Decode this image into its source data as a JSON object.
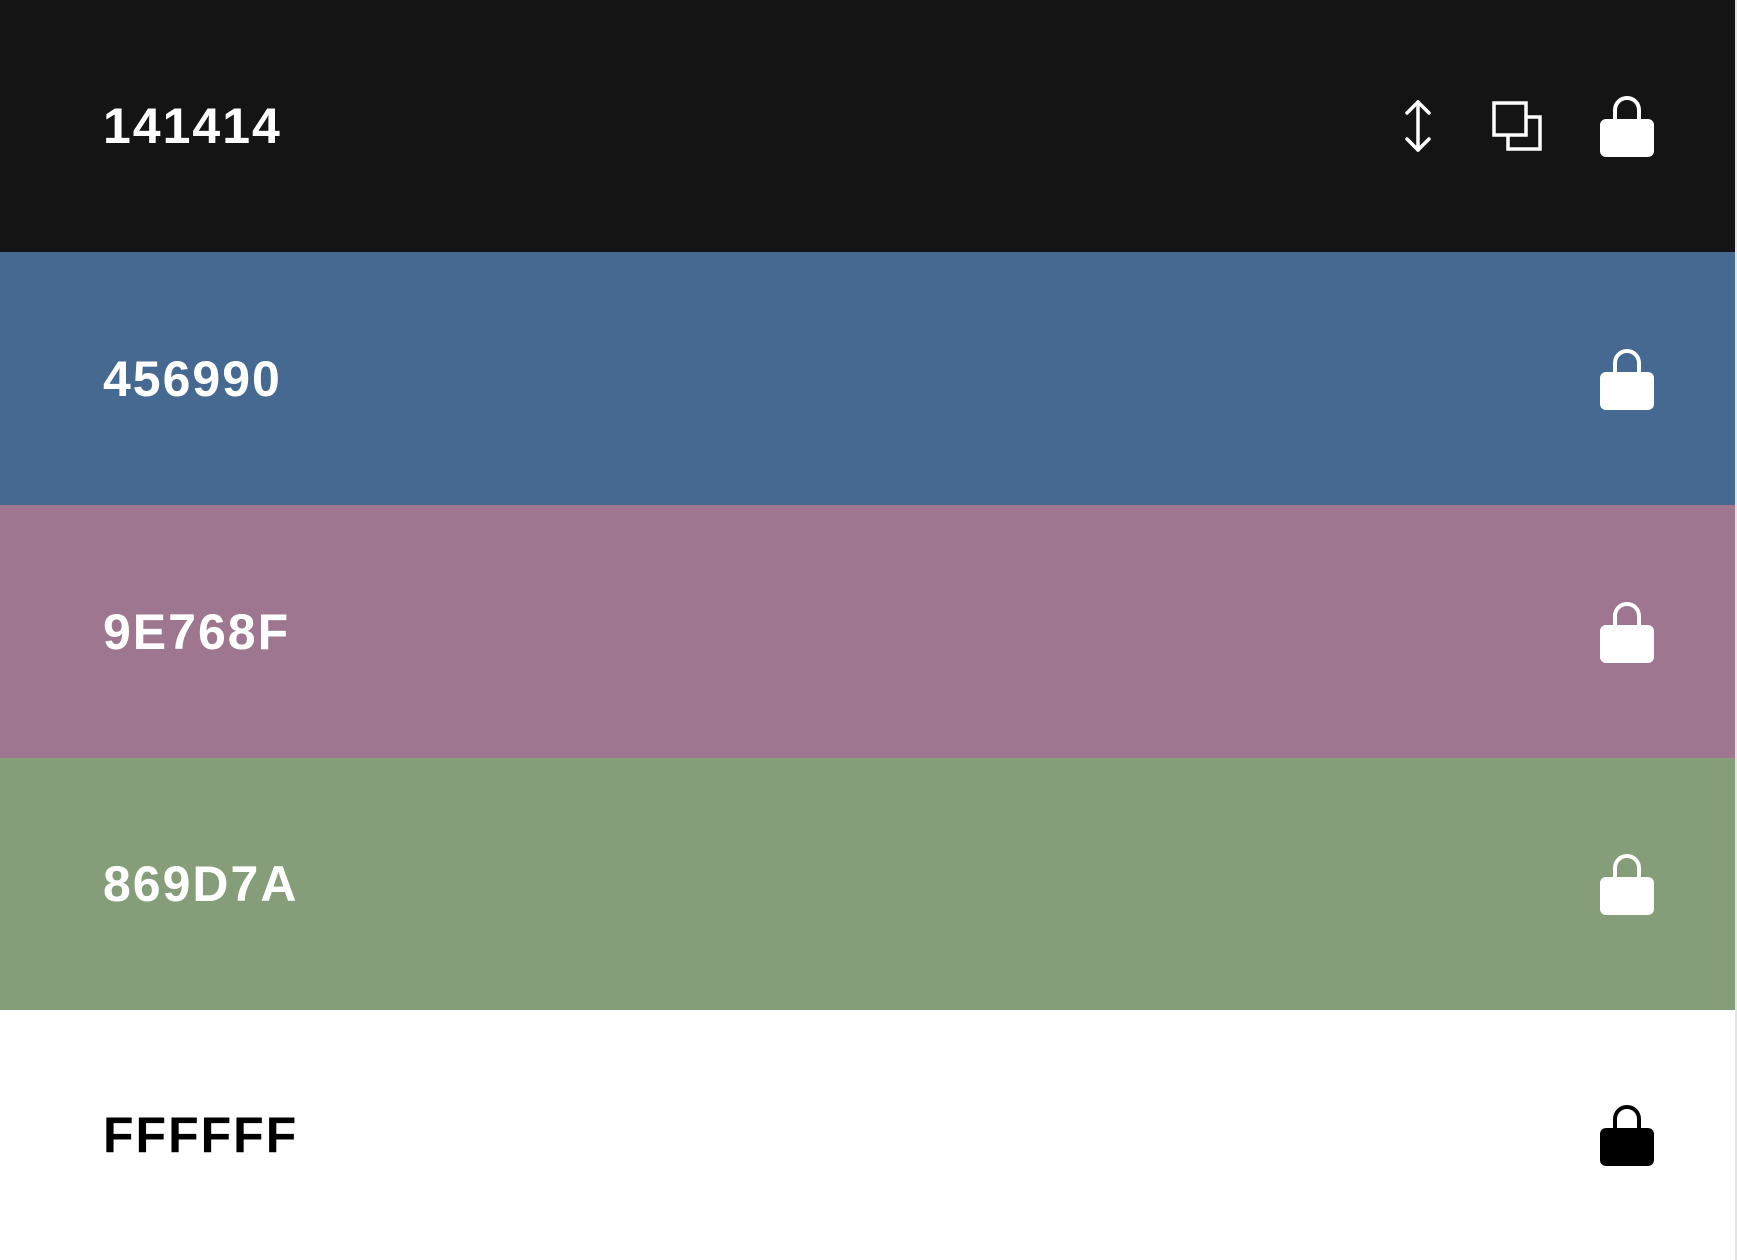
{
  "palette": {
    "colors": [
      {
        "hex": "141414",
        "background": "#141414",
        "text_color": "#ffffff",
        "icons": [
          "drag-handle-icon",
          "copy-icon",
          "lock-icon"
        ]
      },
      {
        "hex": "456990",
        "background": "#456990",
        "text_color": "#ffffff",
        "icons": [
          "lock-icon"
        ]
      },
      {
        "hex": "9E768F",
        "background": "#9e768f",
        "text_color": "#ffffff",
        "icons": [
          "lock-icon"
        ]
      },
      {
        "hex": "869D7A",
        "background": "#869d7a",
        "text_color": "#ffffff",
        "icons": [
          "lock-icon"
        ]
      },
      {
        "hex": "FFFFFF",
        "background": "#ffffff",
        "text_color": "#000000",
        "icons": [
          "lock-icon"
        ]
      }
    ]
  }
}
